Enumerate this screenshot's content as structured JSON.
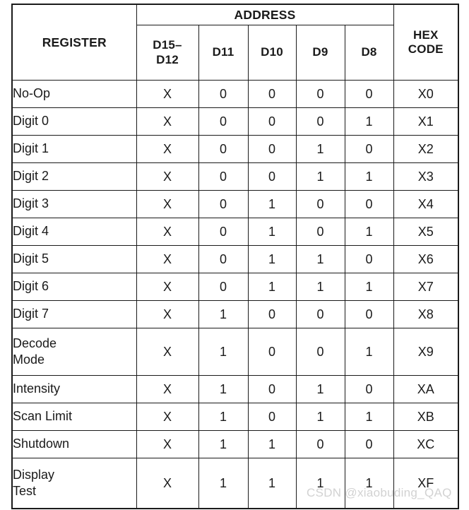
{
  "table": {
    "header": {
      "register_label": "REGISTER",
      "address_label": "ADDRESS",
      "hex_code_label": "HEX\nCODE",
      "address_columns": [
        "D15–\nD12",
        "D11",
        "D10",
        "D9",
        "D8"
      ]
    },
    "rows": [
      {
        "register": "No-Op",
        "bits": [
          "X",
          "0",
          "0",
          "0",
          "0"
        ],
        "hex": "X0"
      },
      {
        "register": "Digit 0",
        "bits": [
          "X",
          "0",
          "0",
          "0",
          "1"
        ],
        "hex": "X1"
      },
      {
        "register": "Digit 1",
        "bits": [
          "X",
          "0",
          "0",
          "1",
          "0"
        ],
        "hex": "X2"
      },
      {
        "register": "Digit 2",
        "bits": [
          "X",
          "0",
          "0",
          "1",
          "1"
        ],
        "hex": "X3"
      },
      {
        "register": "Digit 3",
        "bits": [
          "X",
          "0",
          "1",
          "0",
          "0"
        ],
        "hex": "X4"
      },
      {
        "register": "Digit 4",
        "bits": [
          "X",
          "0",
          "1",
          "0",
          "1"
        ],
        "hex": "X5"
      },
      {
        "register": "Digit 5",
        "bits": [
          "X",
          "0",
          "1",
          "1",
          "0"
        ],
        "hex": "X6"
      },
      {
        "register": "Digit 6",
        "bits": [
          "X",
          "0",
          "1",
          "1",
          "1"
        ],
        "hex": "X7"
      },
      {
        "register": "Digit 7",
        "bits": [
          "X",
          "1",
          "0",
          "0",
          "0"
        ],
        "hex": "X8"
      },
      {
        "register": "Decode\nMode",
        "bits": [
          "X",
          "1",
          "0",
          "0",
          "1"
        ],
        "hex": "X9"
      },
      {
        "register": "Intensity",
        "bits": [
          "X",
          "1",
          "0",
          "1",
          "0"
        ],
        "hex": "XA"
      },
      {
        "register": "Scan Limit",
        "bits": [
          "X",
          "1",
          "0",
          "1",
          "1"
        ],
        "hex": "XB"
      },
      {
        "register": "Shutdown",
        "bits": [
          "X",
          "1",
          "1",
          "0",
          "0"
        ],
        "hex": "XC"
      },
      {
        "register": "Display\nTest",
        "bits": [
          "X",
          "1",
          "1",
          "1",
          "1"
        ],
        "hex": "XF"
      }
    ]
  },
  "watermark": {
    "text": "CSDN @xiaobuding_QAQ",
    "color": "#d2d2d2"
  },
  "colors": {
    "border": "#1a1a1a",
    "text": "#1a1a1a",
    "background": "#ffffff"
  }
}
